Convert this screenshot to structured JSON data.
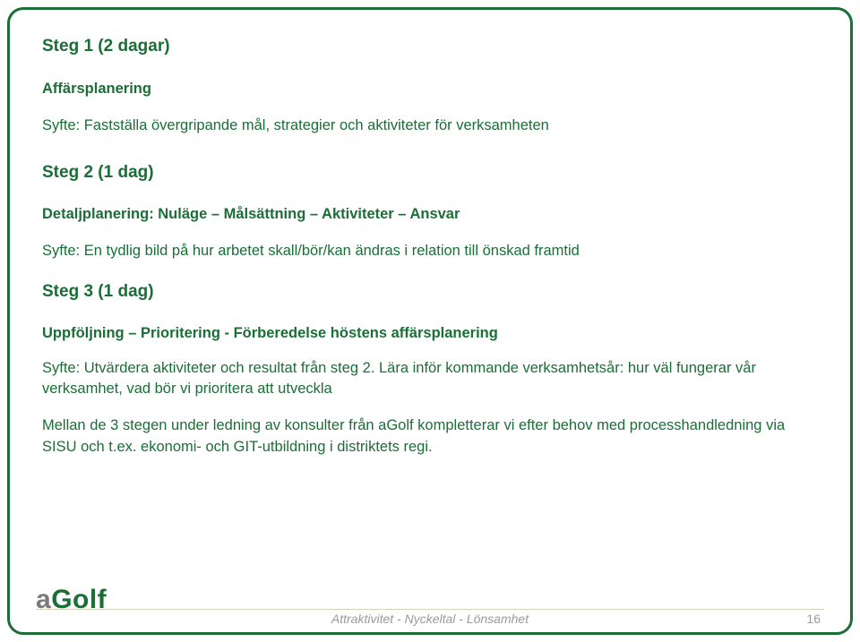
{
  "steps": [
    {
      "title": "Steg 1 (2 dagar)",
      "subhead": "Affärsplanering",
      "body": "Syfte: Fastställa övergripande mål, strategier och aktiviteter för verksamheten"
    },
    {
      "title": "Steg 2 (1 dag)",
      "subhead": "Detaljplanering: Nuläge – Målsättning – Aktiviteter – Ansvar",
      "body": "Syfte: En tydlig bild på hur arbetet skall/bör/kan ändras i relation till önskad framtid"
    },
    {
      "title": "Steg 3 (1 dag)",
      "subhead": "Uppföljning – Prioritering - Förberedelse höstens affärsplanering",
      "body": "Syfte: Utvärdera aktiviteter och resultat från steg 2. Lära inför kommande verksamhetsår: hur väl fungerar vår verksamhet, vad bör vi prioritera att utveckla"
    }
  ],
  "closing": "Mellan de 3 stegen under ledning av konsulter från aGolf kompletterar vi efter behov med processhandledning via SISU och t.ex. ekonomi- och GIT-utbildning i distriktets regi.",
  "footer": {
    "caption": "Attraktivitet - Nyckeltal - Lönsamhet",
    "page": "16",
    "logo": {
      "a": "a",
      "golf": "Golf"
    }
  }
}
